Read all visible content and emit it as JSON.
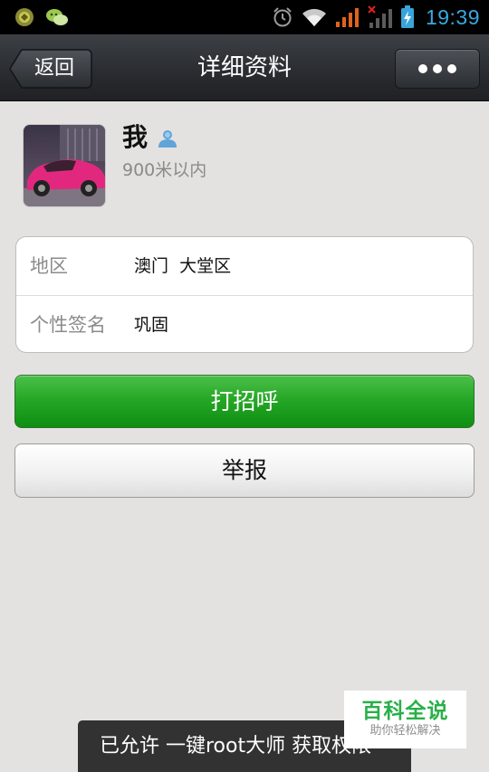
{
  "status_bar": {
    "time": "19:39",
    "icons": [
      "app-notification-icon",
      "wechat-icon",
      "alarm-icon",
      "wifi-icon",
      "signal-icon",
      "no-sim-signal-icon",
      "battery-charging-icon"
    ]
  },
  "header": {
    "back_label": "返回",
    "title": "详细资料",
    "more_icon": "more-dots-icon"
  },
  "profile": {
    "name": "我",
    "contact_icon": "contact-person-icon",
    "distance": "900米以内"
  },
  "details": [
    {
      "label": "地区",
      "value": "澳门  大堂区"
    },
    {
      "label": "个性签名",
      "value": "巩固"
    }
  ],
  "actions": {
    "greet_label": "打招呼",
    "report_label": "举报"
  },
  "toast": {
    "text": "已允许 一键root大师 获取权限"
  },
  "watermark": {
    "title": "百科全说",
    "subtitle": "助你轻松解决"
  },
  "colors": {
    "accent_green": "#27a727",
    "status_time": "#39a9e0",
    "title_bar": "#2a2d31",
    "background": "#e3e2e0"
  }
}
